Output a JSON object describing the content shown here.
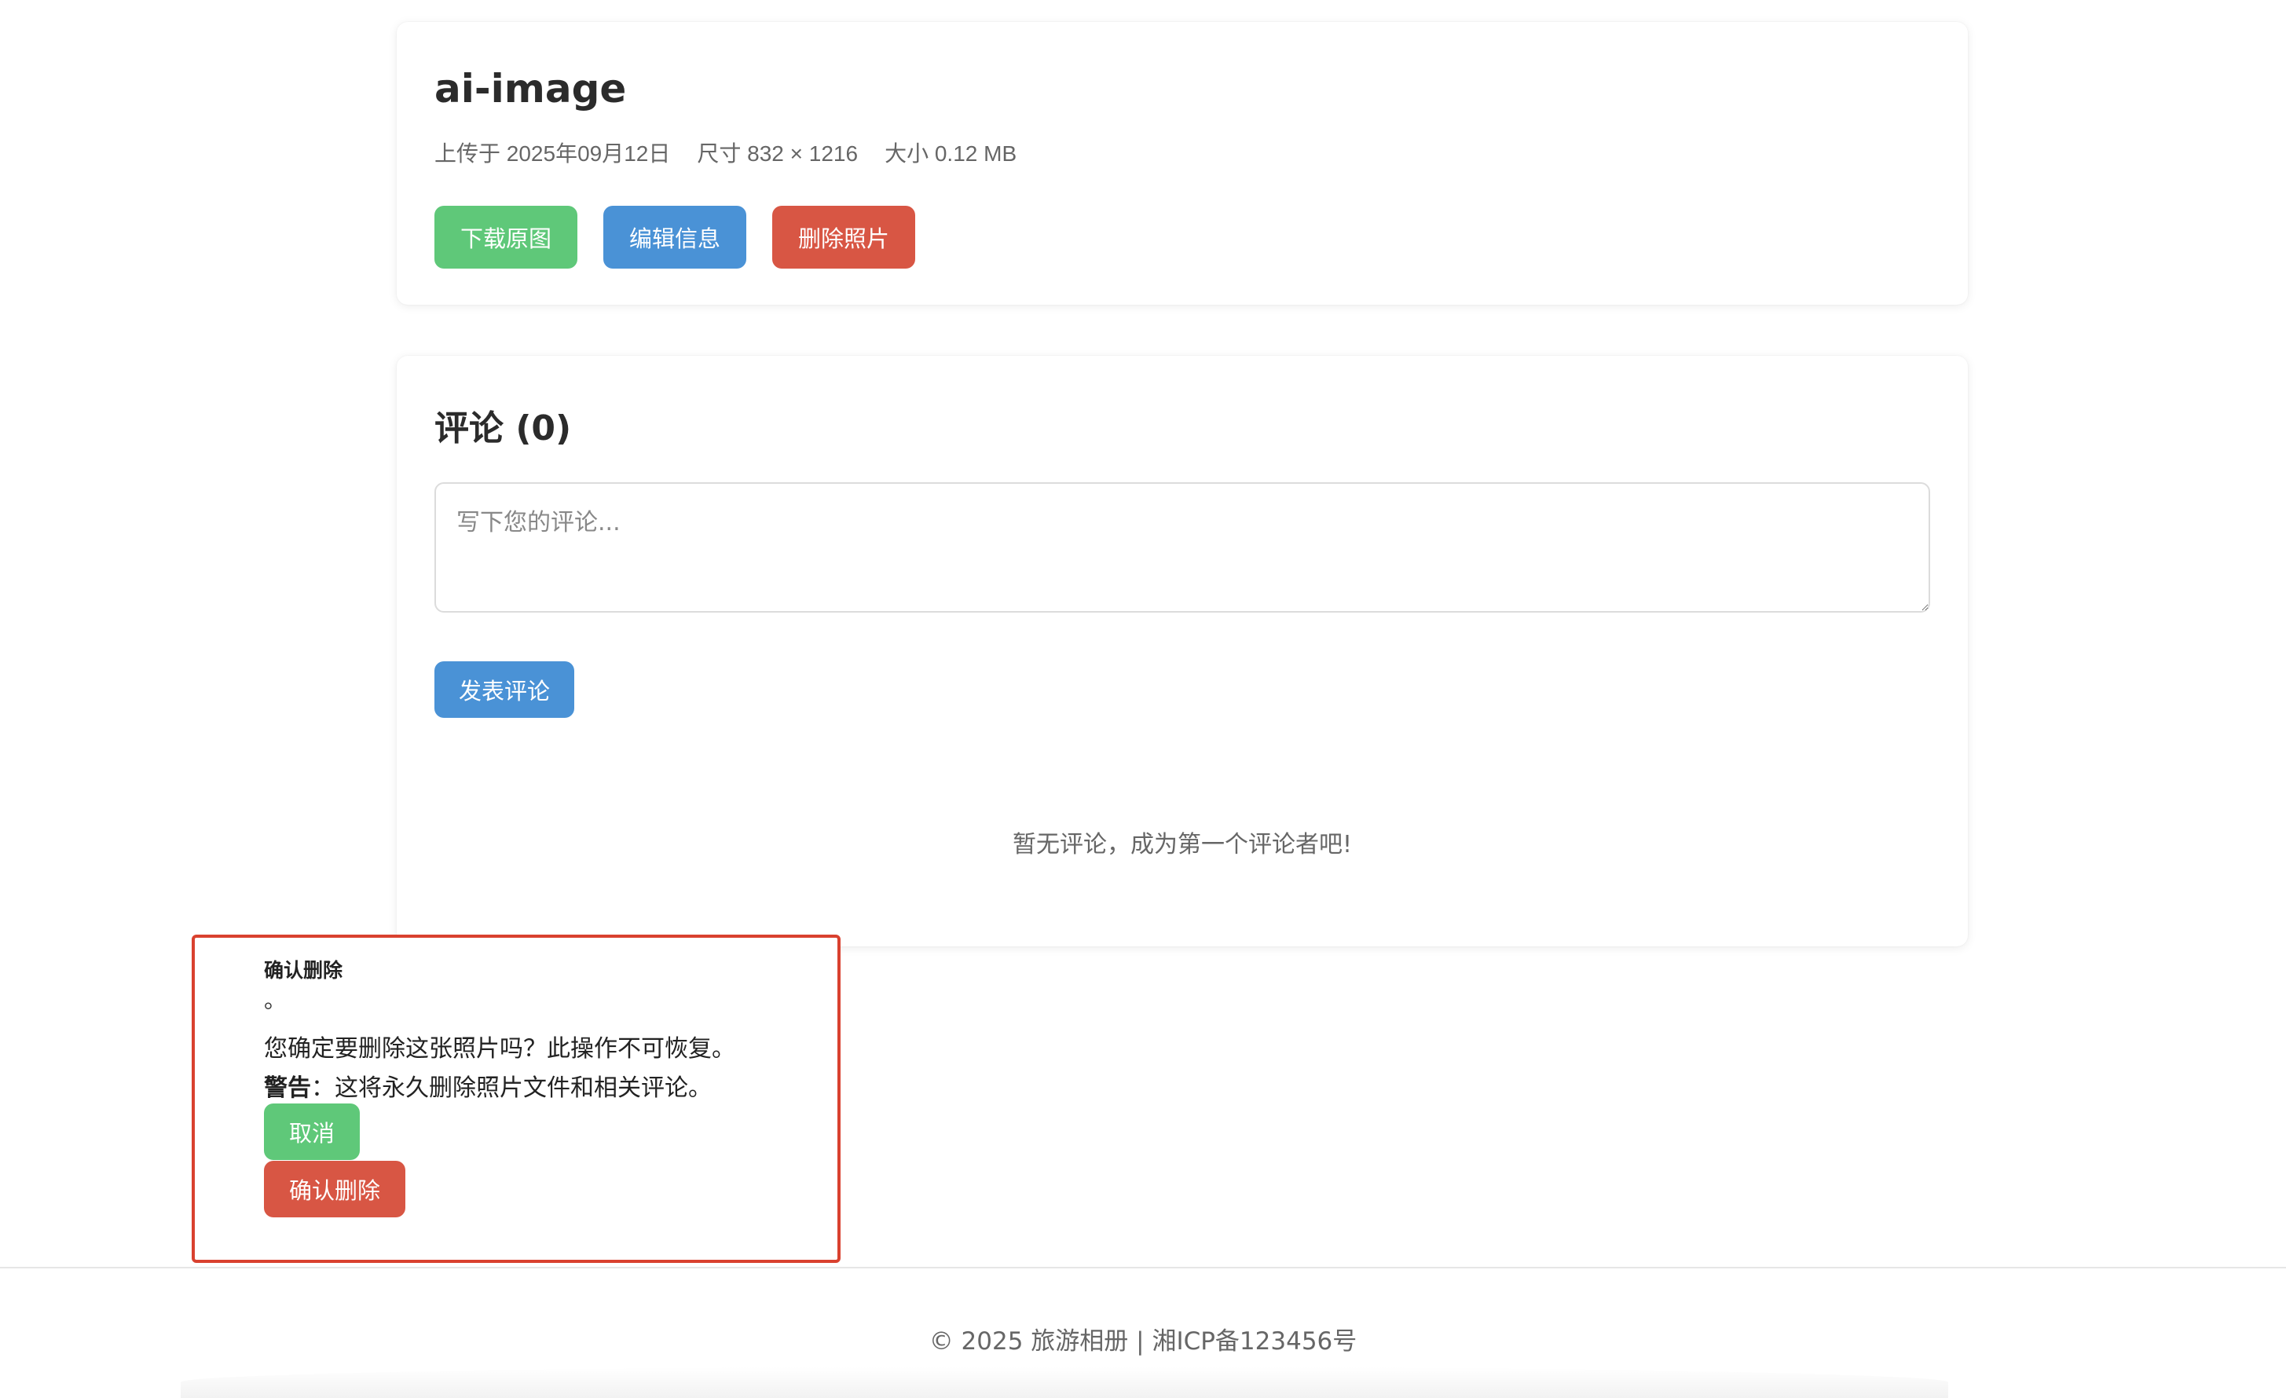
{
  "photo": {
    "title": "ai-image",
    "uploaded": "上传于 2025年09月12日",
    "dimensions": "尺寸 832 × 1216",
    "size": "大小 0.12 MB"
  },
  "actions": {
    "download_label": "下载原图",
    "edit_label": "编辑信息",
    "delete_label": "删除照片"
  },
  "comments": {
    "title": "评论 (0)",
    "placeholder": "写下您的评论...",
    "post_label": "发表评论",
    "empty_message": "暂无评论，成为第一个评论者吧!"
  },
  "delete_dialog": {
    "title": "确认删除",
    "stray_char": "。",
    "message": "您确定要删除这张照片吗？此操作不可恢复。",
    "warning_label": "警告",
    "warning_colon": "：",
    "warning_text": "这将永久删除照片文件和相关评论。",
    "cancel_label": "取消",
    "confirm_label": "确认删除",
    "border_color": "#d9412f"
  },
  "footer": {
    "text": "© 2025 旅游相册 | 湘ICP备123456号"
  },
  "colors": {
    "green": "#5fc879",
    "blue": "#4a92d6",
    "red": "#d85644"
  }
}
